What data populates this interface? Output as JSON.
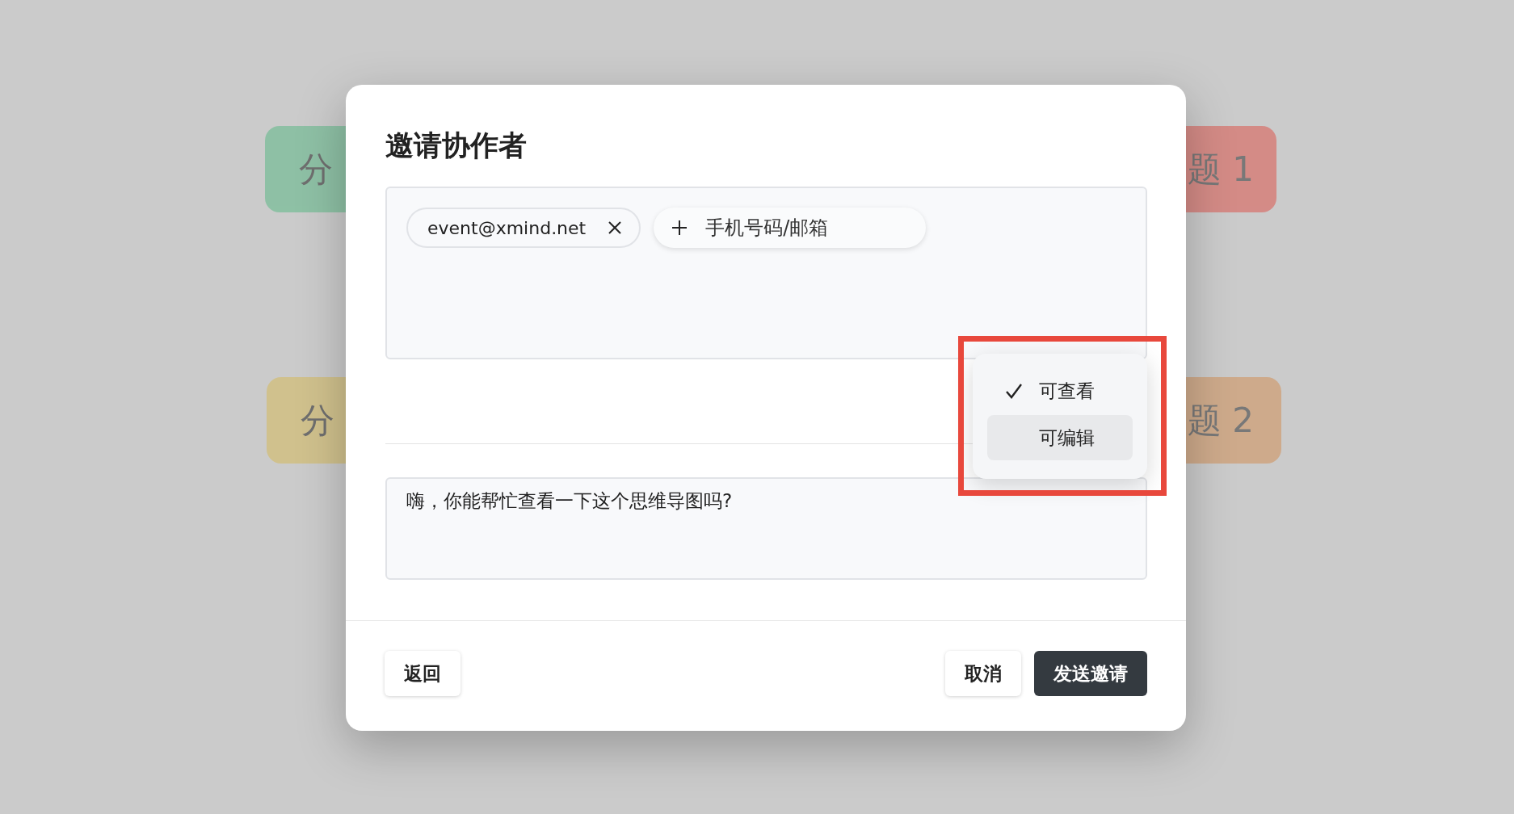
{
  "background_nodes": [
    {
      "text": "分",
      "kind": "left",
      "color": "#84bf9f"
    },
    {
      "text": "分",
      "kind": "left",
      "color": "#d2c083"
    },
    {
      "text": "题 1",
      "kind": "right",
      "color": "#d6807b"
    },
    {
      "text": "题 2",
      "kind": "right",
      "color": "#cfa580"
    }
  ],
  "dialog": {
    "title": "邀请协作者",
    "recipients": [
      {
        "text": "event@xmind.net"
      }
    ],
    "add_field": {
      "placeholder": "手机号码/邮箱"
    },
    "permission_menu": {
      "items": [
        {
          "label": "可查看",
          "selected": true,
          "highlighted": false
        },
        {
          "label": "可编辑",
          "selected": false,
          "highlighted": true
        }
      ]
    },
    "message": {
      "value": "嗨，你能帮忙查看一下这个思维导图吗?"
    },
    "buttons": [
      {
        "label": "返回",
        "kind": "secondary"
      },
      {
        "label": "取消",
        "kind": "secondary"
      },
      {
        "label": "发送邀请",
        "kind": "primary"
      }
    ]
  }
}
